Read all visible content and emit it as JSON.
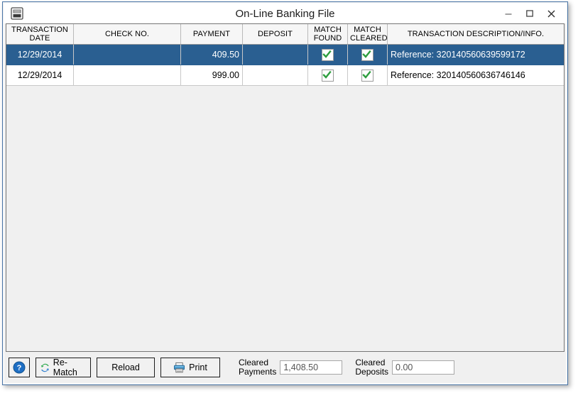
{
  "window": {
    "title": "On-Line Banking File",
    "app_icon": "banking-window-icon",
    "minimize_label": "–",
    "maximize_label": "❑",
    "close_label": "✕"
  },
  "grid": {
    "columns": [
      {
        "id": "date",
        "label": "TRANSACTION\nDATE"
      },
      {
        "id": "check",
        "label": "CHECK NO."
      },
      {
        "id": "payment",
        "label": "PAYMENT"
      },
      {
        "id": "deposit",
        "label": "DEPOSIT"
      },
      {
        "id": "mfound",
        "label": "MATCH\nFOUND"
      },
      {
        "id": "mclear",
        "label": "MATCH\nCLEARED"
      },
      {
        "id": "desc",
        "label": "TRANSACTION DESCRIPTION/INFO."
      }
    ],
    "rows": [
      {
        "date": "12/29/2014",
        "check": "",
        "payment": "409.50",
        "deposit": "",
        "match_found": true,
        "match_cleared": true,
        "description": "Reference: 320140560639599172",
        "selected": true
      },
      {
        "date": "12/29/2014",
        "check": "",
        "payment": "999.00",
        "deposit": "",
        "match_found": true,
        "match_cleared": true,
        "description": "Reference: 320140560636746146",
        "selected": false
      }
    ]
  },
  "toolbar": {
    "help_label": "?",
    "rematch_label": "Re-Match",
    "reload_label": "Reload",
    "print_label": "Print"
  },
  "totals": {
    "cleared_payments_label": "Cleared\nPayments",
    "cleared_payments_value": "1,408.50",
    "cleared_deposits_label": "Cleared\nDeposits",
    "cleared_deposits_value": "0.00"
  },
  "colors": {
    "selection_blue": "#2a5f91",
    "window_border": "#4a76a8",
    "check_green": "#2e9e3e",
    "help_blue": "#1f6fc4",
    "print_blue": "#3f93c9"
  }
}
